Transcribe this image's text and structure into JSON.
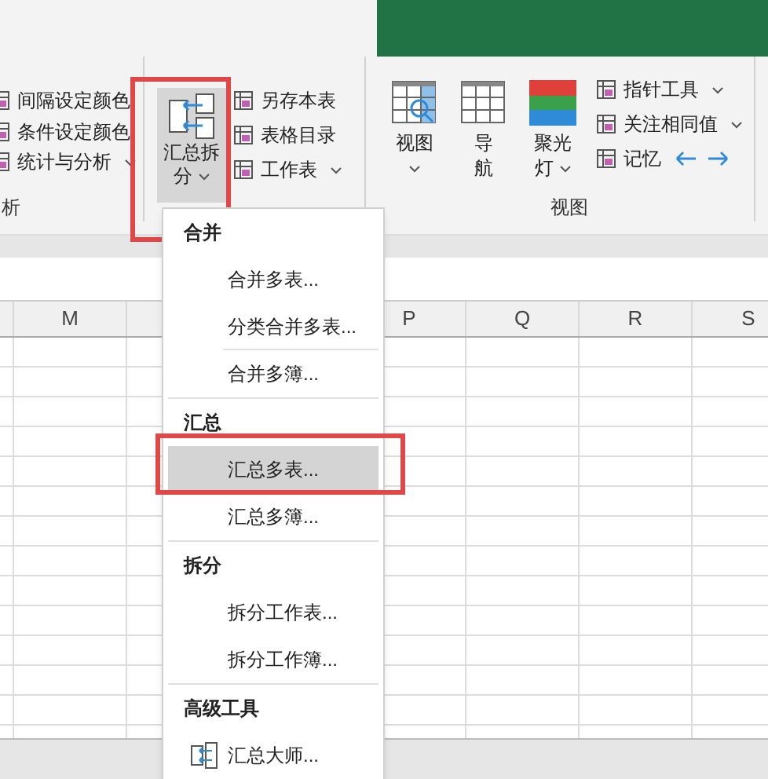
{
  "ribbon": {
    "left_group": {
      "items": [
        {
          "label": "间隔设定颜色",
          "dropdown": false
        },
        {
          "label": "条件设定颜色",
          "dropdown": false
        },
        {
          "label": "统计与分析",
          "dropdown": true
        }
      ],
      "group_label": "析"
    },
    "tools_group": {
      "big_button": {
        "label_line1": "汇总拆",
        "label_line2": "分",
        "selected": true,
        "outlined": true
      },
      "items": [
        {
          "label": "另存本表",
          "dropdown": false
        },
        {
          "label": "表格目录",
          "dropdown": false
        },
        {
          "label": "工作表",
          "dropdown": true
        }
      ]
    },
    "view_group": {
      "big_buttons": [
        {
          "kind": "view",
          "line1": "视图",
          "dropdown": true
        },
        {
          "kind": "grid",
          "line1": "导",
          "line2": "航",
          "dropdown": false
        },
        {
          "kind": "spotlight",
          "line1": "聚光",
          "line2": "灯",
          "dropdown": true
        }
      ],
      "items": [
        {
          "label": "指针工具",
          "dropdown": true,
          "arrows": false
        },
        {
          "label": "关注相同值",
          "dropdown": true,
          "arrows": false
        },
        {
          "label": "记忆",
          "dropdown": false,
          "arrows": true
        }
      ],
      "group_label": "视图"
    }
  },
  "sheet": {
    "columns": [
      {
        "label": "M"
      },
      {
        "label": "P"
      },
      {
        "label": "Q"
      },
      {
        "label": "R"
      },
      {
        "label": "S"
      }
    ]
  },
  "menu": {
    "sections": [
      {
        "header": "合并",
        "items": [
          {
            "label": "合并多表...",
            "selected": false,
            "outlined": false,
            "separator_after": false
          },
          {
            "label": "分类合并多表...",
            "selected": false,
            "outlined": false,
            "separator_after": true
          },
          {
            "label": "合并多簿...",
            "selected": false,
            "outlined": false,
            "separator_after": false
          }
        ]
      },
      {
        "header": "汇总",
        "items": [
          {
            "label": "汇总多表...",
            "selected": true,
            "outlined": true,
            "separator_after": false
          },
          {
            "label": "汇总多簿...",
            "selected": false,
            "outlined": false,
            "separator_after": false
          }
        ]
      },
      {
        "header": "拆分",
        "items": [
          {
            "label": "拆分工作表...",
            "selected": false,
            "outlined": false,
            "separator_after": false
          },
          {
            "label": "拆分工作簿...",
            "selected": false,
            "outlined": false,
            "separator_after": false
          }
        ]
      },
      {
        "header": "高级工具",
        "items": [
          {
            "label": "汇总大师...",
            "selected": false,
            "outlined": false,
            "separator_after": false,
            "icon": true
          }
        ]
      }
    ]
  }
}
